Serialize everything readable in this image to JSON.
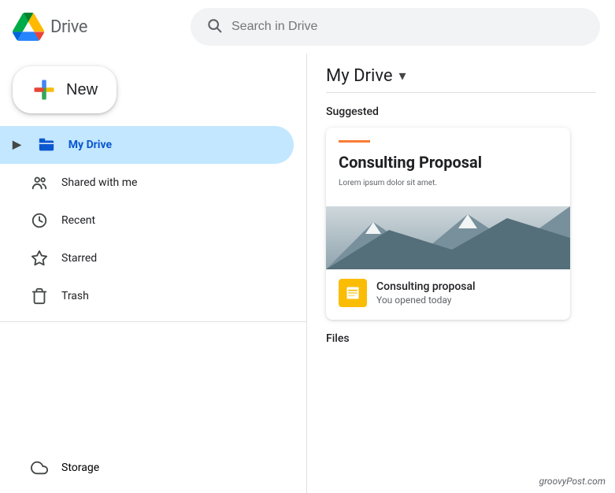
{
  "header": {
    "logo_text": "Drive",
    "search_placeholder": "Search in Drive"
  },
  "new_button": {
    "label": "New"
  },
  "sidebar": {
    "items": [
      {
        "id": "my-drive",
        "label": "My Drive",
        "icon": "cloud-upload",
        "active": true,
        "has_chevron": true
      },
      {
        "id": "shared",
        "label": "Shared with me",
        "icon": "people",
        "active": false,
        "has_chevron": false
      },
      {
        "id": "recent",
        "label": "Recent",
        "icon": "clock",
        "active": false,
        "has_chevron": false
      },
      {
        "id": "starred",
        "label": "Starred",
        "icon": "star",
        "active": false,
        "has_chevron": false
      },
      {
        "id": "trash",
        "label": "Trash",
        "icon": "trash",
        "active": false,
        "has_chevron": false
      }
    ],
    "storage": {
      "label": "Storage",
      "icon": "cloud"
    }
  },
  "content": {
    "title": "My Drive",
    "suggested_label": "Suggested",
    "files_label": "Files",
    "suggested_card": {
      "file_name": "Consulting proposal",
      "file_meta": "You opened today",
      "doc_title": "Consulting Proposal",
      "doc_subtitle": "Lorem ipsum dolor sit amet."
    }
  },
  "watermark": "groovyPost.com"
}
